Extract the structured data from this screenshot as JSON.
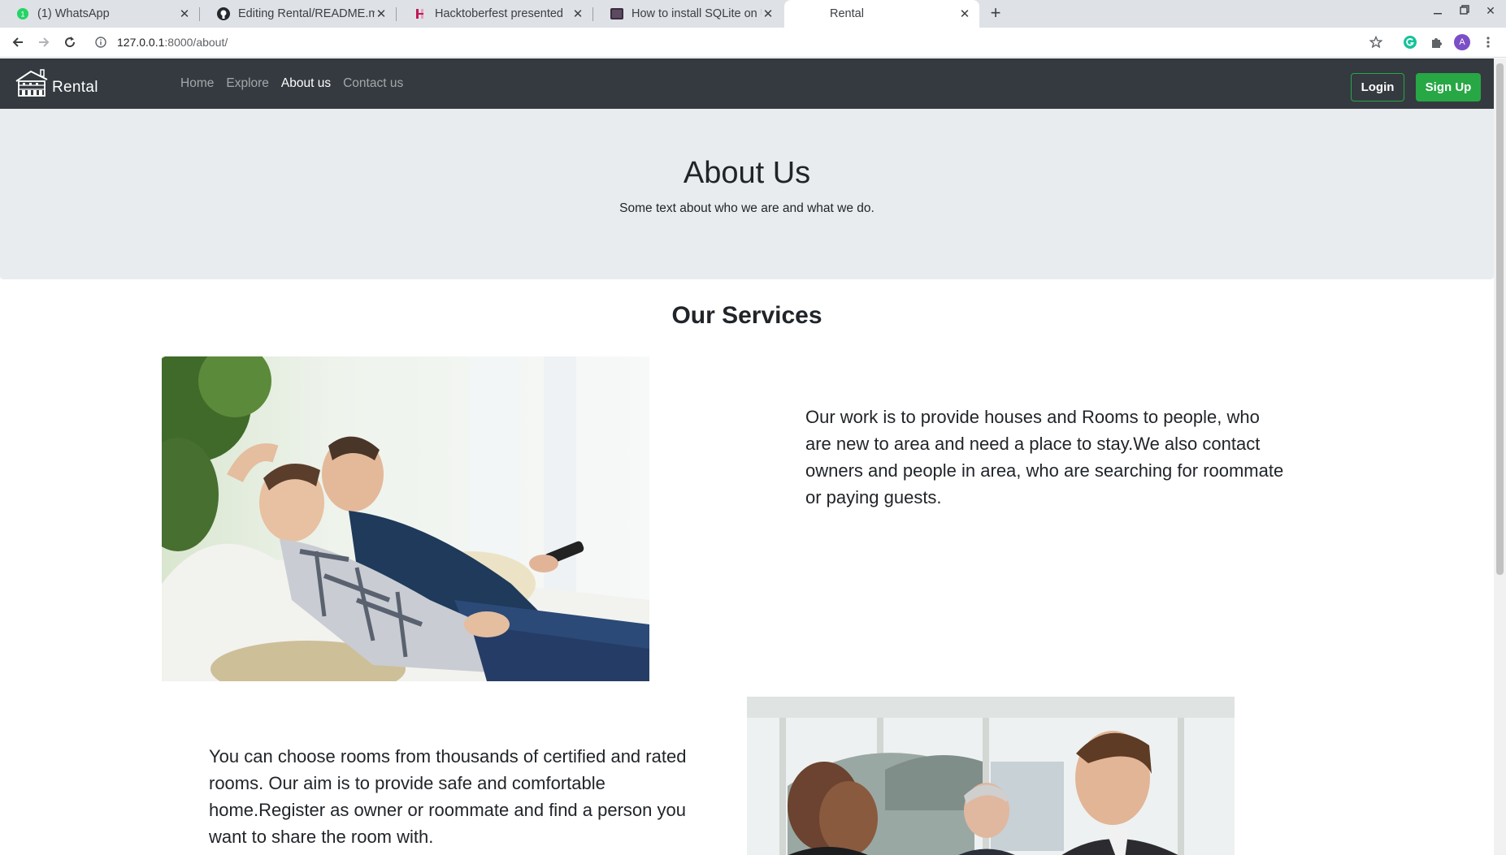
{
  "browser": {
    "tabs": [
      {
        "title": "(1) WhatsApp",
        "icon": "whatsapp-icon"
      },
      {
        "title": "Editing Rental/README.md",
        "icon": "github-icon"
      },
      {
        "title": "Hacktoberfest presented",
        "icon": "hacktoberfest-icon"
      },
      {
        "title": "How to install SQLite on U",
        "icon": "page-icon"
      },
      {
        "title": "Rental",
        "icon": ""
      }
    ],
    "url_host": "127.0.0.1",
    "url_rest": ":8000/about/",
    "profile_initial": "A"
  },
  "navbar": {
    "brand": "Rental",
    "links": [
      "Home",
      "Explore",
      "About us",
      "Contact us"
    ],
    "active_link": "About us",
    "login": "Login",
    "signup": "Sign Up",
    "colors": {
      "background": "#343a40",
      "accent": "#28a745"
    }
  },
  "hero": {
    "title": "About Us",
    "subtitle": "Some text about who we are and what we do."
  },
  "services": {
    "title": "Our Services",
    "items": [
      {
        "text": "Our work is to provide houses and Rooms to people, who are new to area and need a place to stay.We also contact owners and people in area, who are searching for roommate or paying guests."
      },
      {
        "text": "You can choose rooms from thousands of certified and rated rooms. Our aim is to provide safe and comfortable home.Register as owner or roommate and find a person you want to share the room with."
      }
    ]
  }
}
